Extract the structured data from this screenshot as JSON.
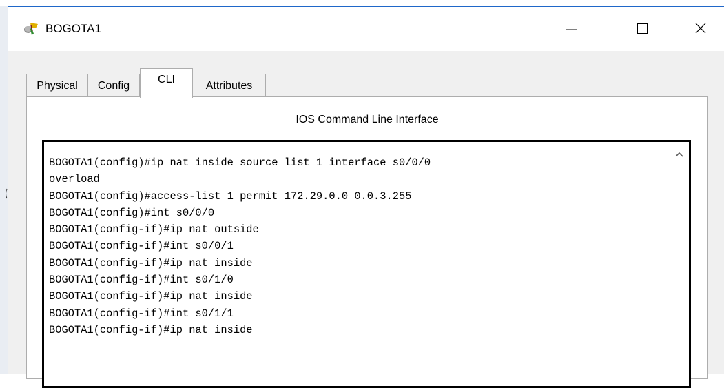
{
  "window": {
    "title": "BOGOTA1",
    "icon": "router-device-icon",
    "controls": {
      "minimize": "minimize-icon",
      "maximize": "maximize-icon",
      "close": "close-icon"
    }
  },
  "tabs": [
    {
      "label": "Physical",
      "active": false
    },
    {
      "label": "Config",
      "active": false
    },
    {
      "label": "CLI",
      "active": true
    },
    {
      "label": "Attributes",
      "active": false
    }
  ],
  "panel": {
    "title": "IOS Command Line Interface"
  },
  "cli": {
    "lines": [
      "BOGOTA1(config)#ip nat inside source list 1 interface s0/0/0",
      "overload",
      "BOGOTA1(config)#access-list 1 permit 172.29.0.0 0.0.3.255",
      "BOGOTA1(config)#int s0/0/0",
      "BOGOTA1(config-if)#ip nat outside",
      "BOGOTA1(config-if)#int s0/0/1",
      "BOGOTA1(config-if)#ip nat inside",
      "BOGOTA1(config-if)#int s0/1/0",
      "BOGOTA1(config-if)#ip nat inside",
      "BOGOTA1(config-if)#int s0/1/1",
      "BOGOTA1(config-if)#ip nat inside"
    ]
  },
  "colors": {
    "window_border": "#1f67c9",
    "window_bg": "#f0f0f0",
    "tab_border": "#adadad"
  }
}
